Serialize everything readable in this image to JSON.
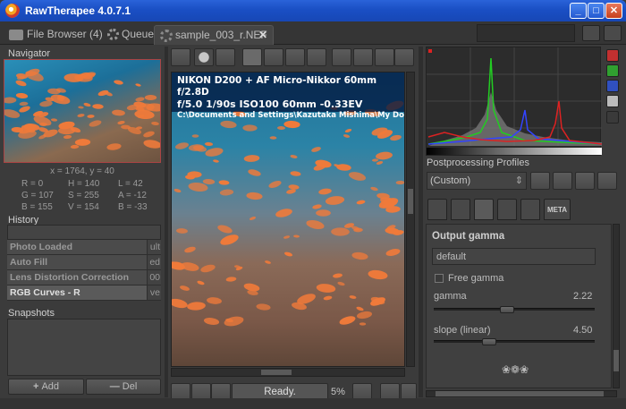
{
  "window": {
    "title": "RawTherapee 4.0.7.1",
    "controls": [
      "minimize-icon",
      "maximize-icon",
      "close-icon"
    ]
  },
  "tabs": [
    {
      "label": "File Browser",
      "count": "(4)"
    },
    {
      "label": "Queue"
    },
    {
      "label": "sample_003_r.NEF",
      "active": true
    }
  ],
  "navigator": {
    "title": "Navigator",
    "coords": "x = 1764, y = 40",
    "values": [
      [
        "R = 0",
        "H = 140",
        "L = 42"
      ],
      [
        "G = 107",
        "S = 255",
        "A = -12"
      ],
      [
        "B = 155",
        "V = 154",
        "B = -33"
      ]
    ]
  },
  "history": {
    "title": "History",
    "items": [
      {
        "label": "Photo Loaded",
        "tail": "ult"
      },
      {
        "label": "Auto Fill",
        "tail": "ed"
      },
      {
        "label": "Lens Distortion Correction",
        "tail": "00"
      },
      {
        "label": "RGB Curves - R",
        "tail": "ve",
        "selected": true
      }
    ]
  },
  "snapshots": {
    "title": "Snapshots",
    "add_label": "Add",
    "del_label": "Del"
  },
  "exif": {
    "line1": "NIKON D200 + AF Micro-Nikkor 60mm f/2.8D",
    "line2": "f/5.0  1/90s  ISO100  60mm  -0.33EV",
    "line3": "C:\\Documents and Settings\\Kazutaka Mishima\\My Documen"
  },
  "status": {
    "ready": "Ready.",
    "zoom": "5%"
  },
  "pp_profiles": {
    "title": "Postprocessing Profiles",
    "selected": "(Custom)"
  },
  "output_gamma": {
    "title": "Output gamma",
    "preset": "default",
    "free_gamma_label": "Free gamma",
    "free_gamma_checked": false,
    "gamma_label": "gamma",
    "gamma_value": "2.22",
    "gamma_level": 0.45,
    "slope_label": "slope (linear)",
    "slope_value": "4.50",
    "slope_level": 0.33
  },
  "colors": {
    "accent": "#1a4fc4",
    "panel": "#3b3b3b",
    "hist_green": "#22cc22",
    "hist_blue": "#3344ff",
    "hist_red": "#dd2222"
  }
}
